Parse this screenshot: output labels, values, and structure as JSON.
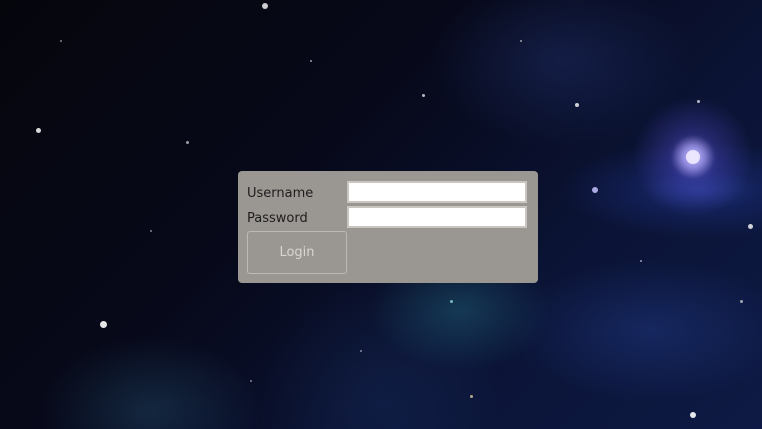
{
  "login": {
    "username_label": "Username",
    "password_label": "Password",
    "username_value": "",
    "password_value": "",
    "login_button": "Login"
  },
  "colors": {
    "panel_background": "#9a9691",
    "button_text": "#d9d6d1",
    "label_text": "#1e1e1e"
  }
}
